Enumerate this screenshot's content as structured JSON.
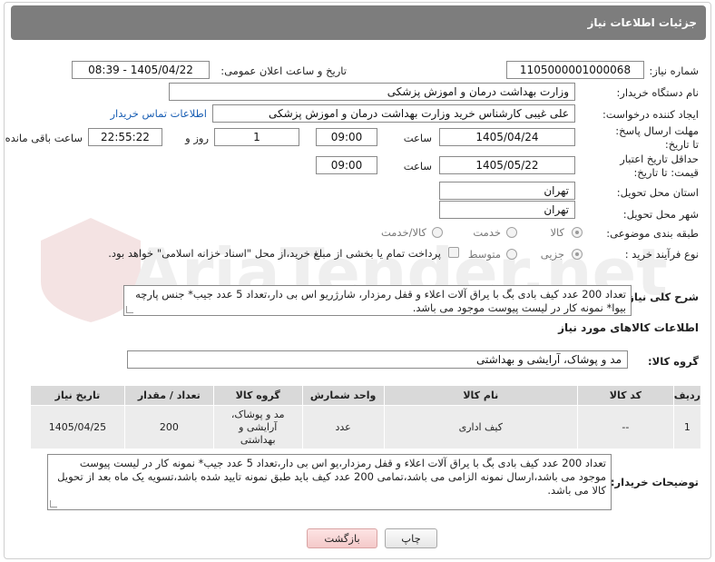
{
  "header": {
    "title": "جزئیات اطلاعات نیاز"
  },
  "fields": {
    "need_number": {
      "label": "شماره نیاز:",
      "value": "1105000001000068"
    },
    "announce_datetime": {
      "label": "تاریخ و ساعت اعلان عمومی:",
      "value": "1405/04/22 - 08:39"
    },
    "buyer_org": {
      "label": "نام دستگاه خریدار:",
      "value": "وزارت بهداشت  درمان و اموزش پزشکی"
    },
    "requester": {
      "label": "ایجاد کننده درخواست:",
      "value": "علی غیبی کارشناس خرید وزارت بهداشت  درمان و اموزش پزشکی",
      "contact_link": "اطلاعات تماس خریدار"
    },
    "reply_deadline": {
      "label": "مهلت ارسال پاسخ: تا تاریخ:",
      "date": "1405/04/24",
      "time_label": "ساعت",
      "time": "09:00",
      "days": "1",
      "days_label": "روز و",
      "remaining": "22:55:22",
      "remaining_label": "ساعت باقی مانده"
    },
    "price_validity": {
      "label": "حداقل تاریخ اعتبار قیمت: تا تاریخ:",
      "date": "1405/05/22",
      "time_label": "ساعت",
      "time": "09:00"
    },
    "delivery_province": {
      "label": "استان محل تحویل:",
      "value": "تهران"
    },
    "delivery_city": {
      "label": "شهر محل تحویل:",
      "value": "تهران"
    },
    "category": {
      "label": "طبقه بندی موضوعی:",
      "options": [
        "کالا",
        "خدمت",
        "کالا/خدمت"
      ],
      "selected": "کالا"
    },
    "purchase_process": {
      "label": "نوع فرآیند خرید :",
      "options": [
        "جزیی",
        "متوسط"
      ],
      "selected": "جزیی",
      "payment_note": "پرداخت تمام یا بخشی از مبلغ خرید،از محل \"اسناد خزانه اسلامی\" خواهد بود."
    }
  },
  "general_description": {
    "label": "شرح کلی نیاز:",
    "value": "تعداد 200 عدد کیف بادی بگ با یراق آلات اعلاء و قفل رمزدار، شارژریو اس بی دار،تعداد 5 عدد جیب* جنس پارچه بیوا* نمونه کار در لیست پیوست موجود می باشد."
  },
  "goods_info": {
    "section_title": "اطلاعات کالاهای مورد نیاز",
    "group_label": "گروه کالا:",
    "group_value": "مد و پوشاک، آرایشی و بهداشتی",
    "columns": [
      "ردیف",
      "کد کالا",
      "نام کالا",
      "واحد شمارش",
      "گروه کالا",
      "تعداد / مقدار",
      "تاریخ نیاز"
    ],
    "rows": [
      {
        "row": "1",
        "code": "--",
        "name": "کیف اداری",
        "unit": "عدد",
        "group": "مد و پوشاک، آرایشی و بهداشتی",
        "qty": "200",
        "date": "1405/04/25"
      }
    ]
  },
  "buyer_notes": {
    "label": "توضیحات خریدار:",
    "value": "تعداد 200 عدد کیف بادی بگ با یراق آلات اعلاء و قفل رمزدار،یو اس بی دار،تعداد 5 عدد جیب* نمونه کار در لیست پیوست موجود می باشد،ارسال نمونه الزامی می باشد،تمامی 200 عدد کیف باید طبق نمونه تایید شده باشد،تسویه یک ماه بعد از تحویل کالا می باشد."
  },
  "buttons": {
    "print": "چاپ",
    "back": "بازگشت"
  },
  "watermark": {
    "text": "AriaTender.net"
  }
}
